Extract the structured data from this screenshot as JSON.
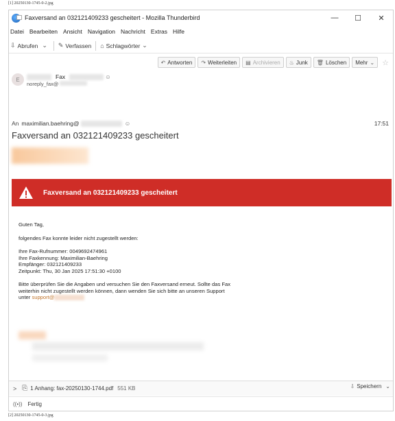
{
  "captions": {
    "top": "[1] 20250130-1745-0-2.jpg",
    "bottom": "[2] 20250130-1745-0-3.jpg"
  },
  "window": {
    "title": "Faxversand an 032121409233 gescheitert - Mozilla Thunderbird",
    "minimize": "—",
    "maximize": "☐",
    "close": "✕"
  },
  "menu": [
    "Datei",
    "Bearbeiten",
    "Ansicht",
    "Navigation",
    "Nachricht",
    "Extras",
    "Hilfe"
  ],
  "toolbar": {
    "get_mail": "Abrufen",
    "compose": "Verfassen",
    "tags": "Schlagwörter"
  },
  "header_actions": {
    "reply": "Antworten",
    "forward": "Weiterleiten",
    "archive": "Archivieren",
    "junk": "Junk",
    "delete": "Löschen",
    "more": "Mehr"
  },
  "message": {
    "avatar_letter": "E",
    "sender_name": "Fax",
    "sender_address": "noreply_fax@",
    "to_label": "An",
    "to_address": "maximilian.baehring@",
    "time": "17:51",
    "subject": "Faxversand an 032121409233 gescheitert"
  },
  "banner": {
    "text": "Faxversand an 032121409233 gescheitert",
    "color": "#cf2d27"
  },
  "body": {
    "greeting": "Guten Tag,",
    "intro": "folgendes Fax konnte leider nicht zugestellt werden:",
    "line1": "Ihre Fax-Rufnummer: 0049692474961",
    "line2": "Ihre Faxkennung: Maximilian-Baehring",
    "line3": "Empfänger: 032121409233",
    "line4": "Zeitpunkt: Thu, 30 Jan 2025 17:51:30 +0100",
    "para1": "Bitte überprüfen Sie die Angaben und versuchen Sie den Faxversand erneut. Sollte das Fax",
    "para2": "weiterhin nicht zugestellt werden können, dann wenden Sie sich bitte an unseren Support",
    "para3_prefix": "unter",
    "link_text": "support@"
  },
  "attachment": {
    "label": "1 Anhang: fax-20250130-1744.pdf",
    "size": "551 KB",
    "save": "Speichern"
  },
  "status": {
    "text": "Fertig"
  }
}
